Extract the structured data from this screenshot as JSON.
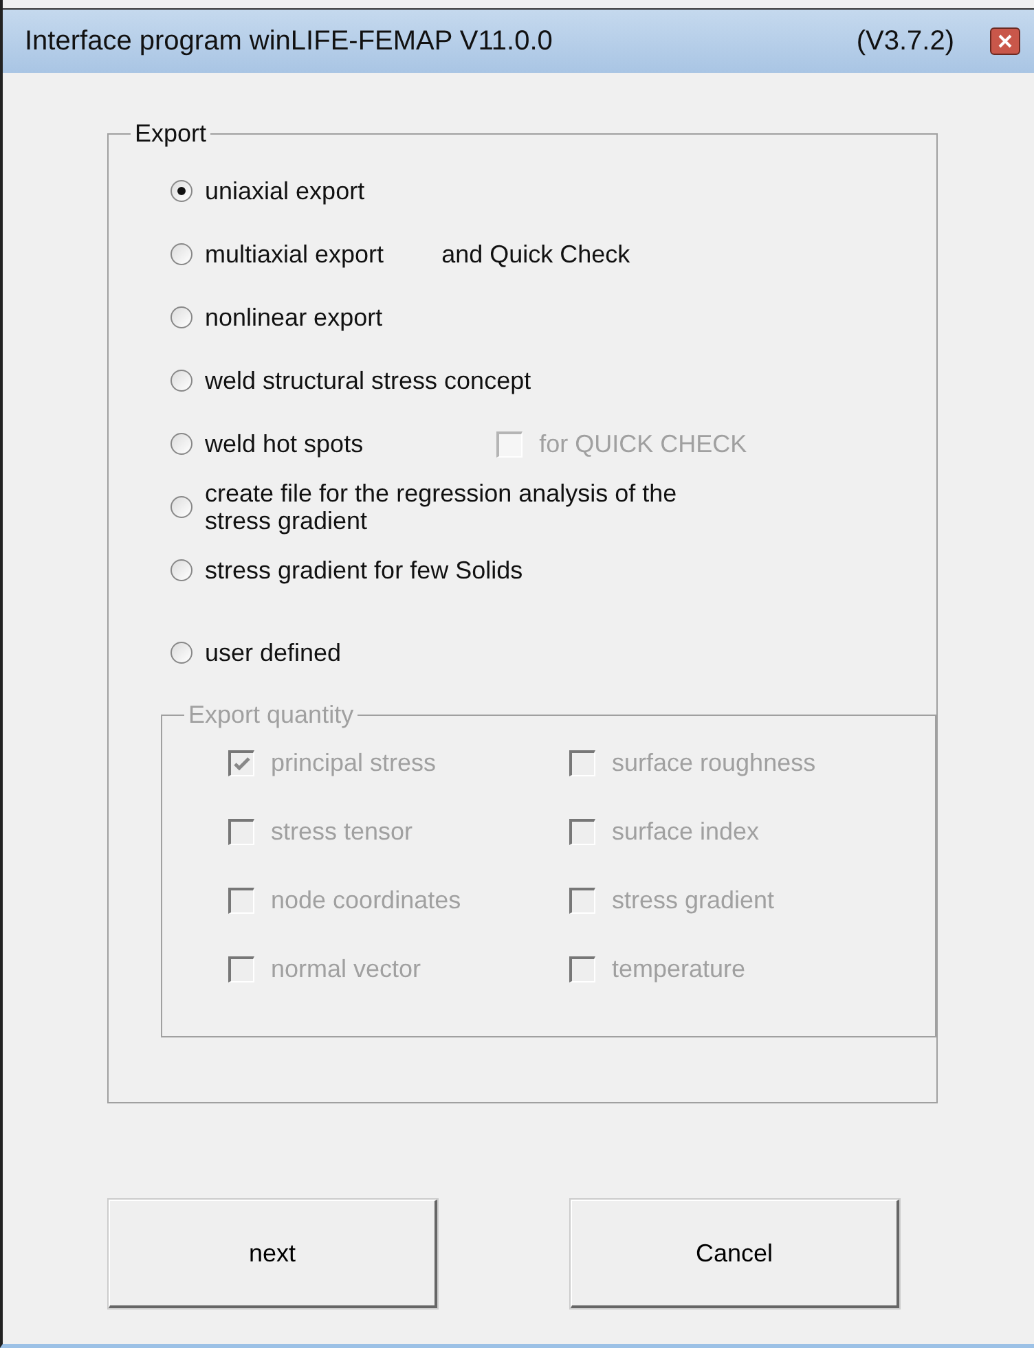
{
  "window": {
    "title": "Interface program winLIFE-FEMAP V11.0.0",
    "version": "(V3.7.2)"
  },
  "export": {
    "title": "Export",
    "options": [
      {
        "label": "uniaxial export",
        "selected": true
      },
      {
        "label": "multiaxial export",
        "selected": false,
        "extra": "and Quick Check"
      },
      {
        "label": "nonlinear export",
        "selected": false
      },
      {
        "label": "weld structural stress concept",
        "selected": false
      },
      {
        "label": "weld hot spots",
        "selected": false,
        "checkbox": {
          "label": "for QUICK CHECK",
          "checked": false,
          "disabled": true
        }
      },
      {
        "label": "create file for the regression analysis of the stress gradient",
        "selected": false
      },
      {
        "label": "stress gradient for few Solids",
        "selected": false
      },
      {
        "label": "user defined",
        "selected": false
      }
    ]
  },
  "quantity": {
    "title": "Export quantity",
    "disabled": true,
    "items": [
      {
        "label": "principal stress",
        "checked": true
      },
      {
        "label": "surface roughness",
        "checked": false
      },
      {
        "label": "stress tensor",
        "checked": false
      },
      {
        "label": "surface index",
        "checked": false
      },
      {
        "label": "node coordinates",
        "checked": false
      },
      {
        "label": "stress gradient",
        "checked": false
      },
      {
        "label": "normal vector",
        "checked": false
      },
      {
        "label": "temperature",
        "checked": false
      }
    ]
  },
  "buttons": [
    "next",
    "Cancel"
  ]
}
